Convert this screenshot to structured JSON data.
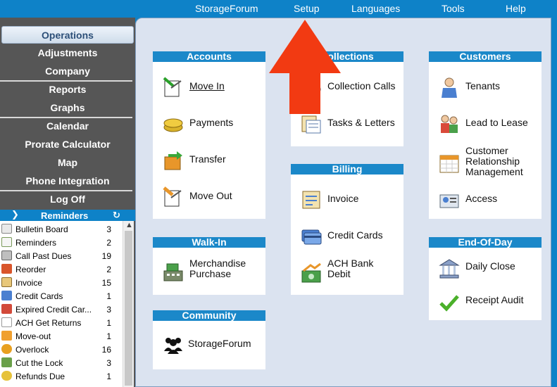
{
  "menu": {
    "items": [
      "StorageForum",
      "Setup",
      "Languages",
      "Tools",
      "Help"
    ]
  },
  "sidebar": {
    "items": [
      "Operations",
      "Adjustments",
      "Company",
      "Reports",
      "Graphs",
      "Calendar",
      "Prorate Calculator",
      "Map",
      "Phone Integration",
      "Log Off"
    ]
  },
  "reminders": {
    "title": "Reminders",
    "items": [
      {
        "label": "Bulletin Board",
        "count": "3"
      },
      {
        "label": "Reminders",
        "count": "2"
      },
      {
        "label": "Call Past Dues",
        "count": "19"
      },
      {
        "label": "Reorder",
        "count": "2"
      },
      {
        "label": "Invoice",
        "count": "15"
      },
      {
        "label": "Credit Cards",
        "count": "1"
      },
      {
        "label": "Expired Credit Car...",
        "count": "3"
      },
      {
        "label": "ACH Get Returns",
        "count": "1"
      },
      {
        "label": "Move-out",
        "count": "1"
      },
      {
        "label": "Overlock",
        "count": "16"
      },
      {
        "label": "Cut the Lock",
        "count": "3"
      },
      {
        "label": "Refunds Due",
        "count": "1"
      }
    ]
  },
  "sections": {
    "accounts": {
      "title": "Accounts",
      "items": [
        "Move In",
        "Payments",
        "Transfer",
        "Move Out"
      ]
    },
    "collections": {
      "title": "Collections",
      "items": [
        "Collection Calls",
        "Tasks & Letters"
      ]
    },
    "customers": {
      "title": "Customers",
      "items": [
        "Tenants",
        "Lead to Lease",
        "Customer Relationship Management",
        "Access"
      ]
    },
    "billing": {
      "title": "Billing",
      "items": [
        "Invoice",
        "Credit Cards",
        "ACH Bank Debit"
      ]
    },
    "walkin": {
      "title": "Walk-In",
      "items": [
        "Merchandise Purchase"
      ]
    },
    "endofday": {
      "title": "End-Of-Day",
      "items": [
        "Daily Close",
        "Receipt Audit"
      ]
    },
    "community": {
      "title": "Community",
      "items": [
        "StorageForum"
      ]
    }
  },
  "colors": {
    "accent": "#0e82c8",
    "sidebar": "#565656",
    "panel": "#dbe3f0",
    "arrow": "#f23a12"
  }
}
